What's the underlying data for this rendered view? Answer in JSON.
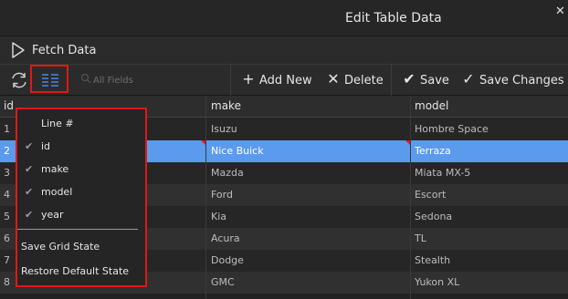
{
  "window": {
    "title": "Edit Table Data",
    "close_glyph": "✕"
  },
  "fetch": {
    "label": "Fetch Data",
    "icon": "play-outline-icon"
  },
  "toolbar": {
    "search_placeholder": "All Fields",
    "add_label": "Add New",
    "delete_label": "Delete",
    "save_label": "Save",
    "save_changes_label": "Save Changes"
  },
  "grid": {
    "columns": [
      "id",
      "make",
      "model"
    ],
    "rows": [
      {
        "id": "1",
        "make": "Isuzu",
        "model": "Hombre Space"
      },
      {
        "id": "2",
        "make": "Nice Buick",
        "model": "Terraza"
      },
      {
        "id": "3",
        "make": "Mazda",
        "model": "Miata MX-5"
      },
      {
        "id": "4",
        "make": "Ford",
        "model": "Escort"
      },
      {
        "id": "5",
        "make": "Kia",
        "model": "Sedona"
      },
      {
        "id": "6",
        "make": "Acura",
        "model": "TL"
      },
      {
        "id": "7",
        "make": "Dodge",
        "model": "Stealth"
      },
      {
        "id": "8",
        "make": "GMC",
        "model": "Yukon XL"
      }
    ],
    "selected_row": 1
  },
  "column_menu": {
    "line_number": "Line #",
    "items": [
      {
        "label": "id",
        "checked": true
      },
      {
        "label": "make",
        "checked": true
      },
      {
        "label": "model",
        "checked": true
      },
      {
        "label": "year",
        "checked": true
      }
    ],
    "save_state": "Save Grid State",
    "restore_state": "Restore Default State"
  },
  "colors": {
    "selection": "#5a9bee",
    "highlight_border": "#e01818",
    "accent_icon": "#4a8fe8"
  }
}
